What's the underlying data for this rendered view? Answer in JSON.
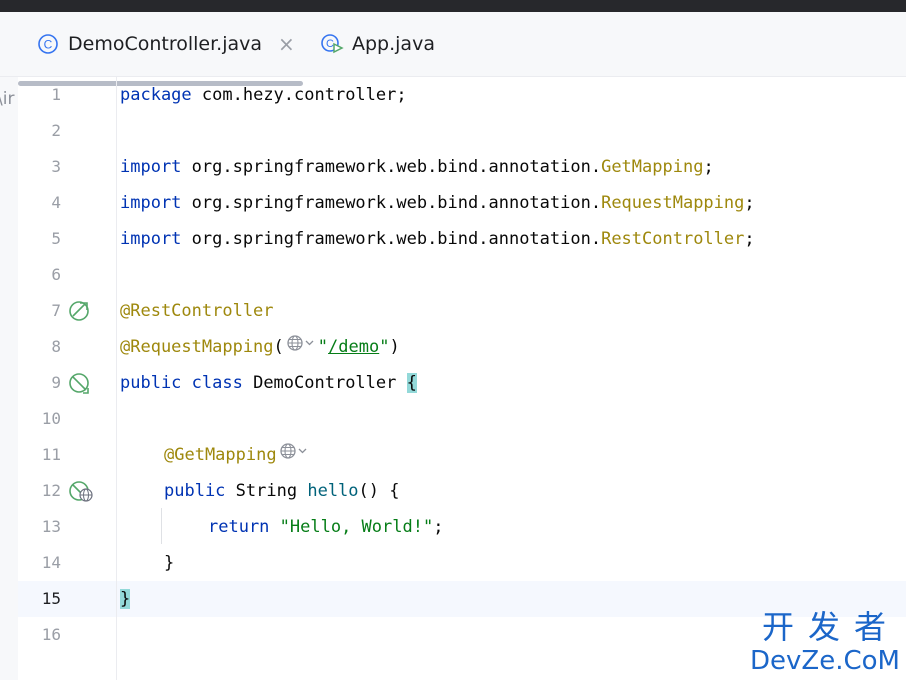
{
  "tabs": [
    {
      "label": "DemoController.java",
      "icon": "class-icon",
      "active": true
    },
    {
      "label": "App.java",
      "icon": "app-run-icon",
      "active": false
    }
  ],
  "close_glyph": "×",
  "left_panel_fragment": "\\ir",
  "editor": {
    "current_line": 15,
    "lines": [
      {
        "n": "1"
      },
      {
        "n": "2"
      },
      {
        "n": "3"
      },
      {
        "n": "4"
      },
      {
        "n": "5"
      },
      {
        "n": "6"
      },
      {
        "n": "7"
      },
      {
        "n": "8"
      },
      {
        "n": "9"
      },
      {
        "n": "10"
      },
      {
        "n": "11"
      },
      {
        "n": "12"
      },
      {
        "n": "13"
      },
      {
        "n": "14"
      },
      {
        "n": "15"
      },
      {
        "n": "16"
      }
    ],
    "tokens": {
      "l1": [
        "package",
        "com.hezy.controller;"
      ],
      "l3": [
        "import",
        "org.springframework.web.bind.annotation.",
        "GetMapping",
        ";"
      ],
      "l4": [
        "import",
        "org.springframework.web.bind.annotation.",
        "RequestMapping",
        ";"
      ],
      "l5": [
        "import",
        "org.springframework.web.bind.annotation.",
        "RestController",
        ";"
      ],
      "l7": [
        "@RestController"
      ],
      "l8": [
        "@RequestMapping",
        "(",
        "\"",
        "/demo",
        "\"",
        ")"
      ],
      "l9": [
        "public class",
        "DemoController",
        "{"
      ],
      "l11": [
        "@GetMapping"
      ],
      "l12": [
        "public",
        "String",
        "hello",
        "()",
        "{"
      ],
      "l13": [
        "return",
        "\"Hello, World!\"",
        ";"
      ],
      "l14": [
        "}"
      ],
      "l15": [
        "}"
      ]
    }
  },
  "watermark": {
    "line1": "开发者",
    "line2": "DevZe.CoM"
  },
  "colors": {
    "keyword": "#0033b3",
    "annotation": "#9e880d",
    "string": "#067d17",
    "method": "#00627a",
    "watermark": "#1b66c9"
  }
}
